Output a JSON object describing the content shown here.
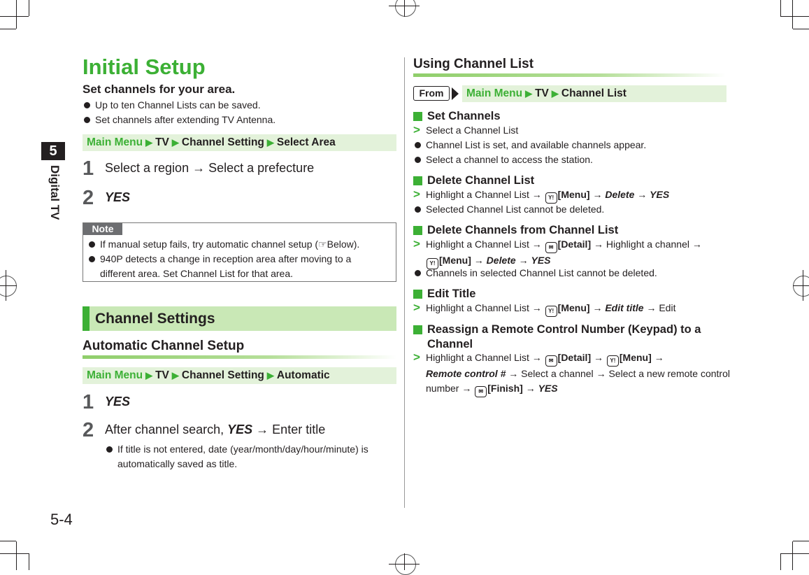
{
  "chapter": {
    "number": "5",
    "label": "Digital TV"
  },
  "page_number": "5-4",
  "left": {
    "title": "Initial Setup",
    "subtitle": "Set channels for your area.",
    "bullets": [
      "Up to ten Channel Lists can be saved.",
      "Set channels after extending TV Antenna."
    ],
    "breadcrumb1": {
      "first": "Main Menu",
      "items": [
        "TV",
        "Channel Setting",
        "Select Area"
      ]
    },
    "steps1": [
      {
        "num": "1",
        "text_a": "Select a region",
        "arrow": "→",
        "text_b": "Select a prefecture"
      },
      {
        "num": "2",
        "text": "YES"
      }
    ],
    "note": {
      "tag": "Note",
      "items": [
        {
          "text": "If manual setup fails, try automatic channel setup (",
          "ref_icon": "☞",
          "ref_text": "Below)."
        },
        {
          "text": "940P detects a change in reception area after moving to a different area. Set Channel List for that area."
        }
      ]
    },
    "section_header": "Channel Settings",
    "auto_heading": "Automatic Channel Setup",
    "breadcrumb2": {
      "first": "Main Menu",
      "items": [
        "TV",
        "Channel Setting",
        "Automatic"
      ]
    },
    "steps2": [
      {
        "num": "1",
        "text": "YES"
      },
      {
        "num": "2",
        "text_a": "After channel search, ",
        "bold": "YES",
        "arrow": "→",
        "text_b": "Enter title",
        "sub_bullet": "If title is not entered, date (year/month/day/hour/minute) is automatically saved as title."
      }
    ]
  },
  "right": {
    "heading": "Using Channel List",
    "from_label": "From",
    "breadcrumb": {
      "first": "Main Menu",
      "items": [
        "TV",
        "Channel List"
      ]
    },
    "sections": [
      {
        "title": "Set Channels",
        "proc": "Select a Channel List",
        "bullets": [
          "Channel List is set, and available channels appear.",
          "Select a channel to access the station."
        ]
      },
      {
        "title": "Delete Channel List",
        "proc_parts": [
          "Highlight a Channel List",
          "[Menu]",
          "Delete",
          "YES"
        ],
        "bullets": [
          "Selected Channel List cannot be deleted."
        ]
      },
      {
        "title": "Delete Channels from Channel List",
        "proc_parts": [
          "Highlight a Channel List",
          "[Detail]",
          "Highlight a channel",
          "[Menu]",
          "Delete",
          "YES"
        ],
        "bullets": [
          "Channels in selected Channel List cannot be deleted."
        ]
      },
      {
        "title": "Edit Title",
        "proc_parts": [
          "Highlight a Channel List",
          "[Menu]",
          "Edit title",
          "Edit"
        ]
      },
      {
        "title_line1": "Reassign a Remote Control Number (Keypad) to a",
        "title_line2": "Channel",
        "proc_parts": [
          "Highlight a Channel List",
          "[Detail]",
          "[Menu]",
          "Remote control #",
          "Select a channel",
          "Select a new remote control number",
          "[Finish]",
          "YES"
        ]
      }
    ],
    "icons": {
      "yahoo_key": "Y!",
      "mail_key": "✉",
      "arrow": "→",
      "breadcrumb_arrow": "▶"
    }
  }
}
